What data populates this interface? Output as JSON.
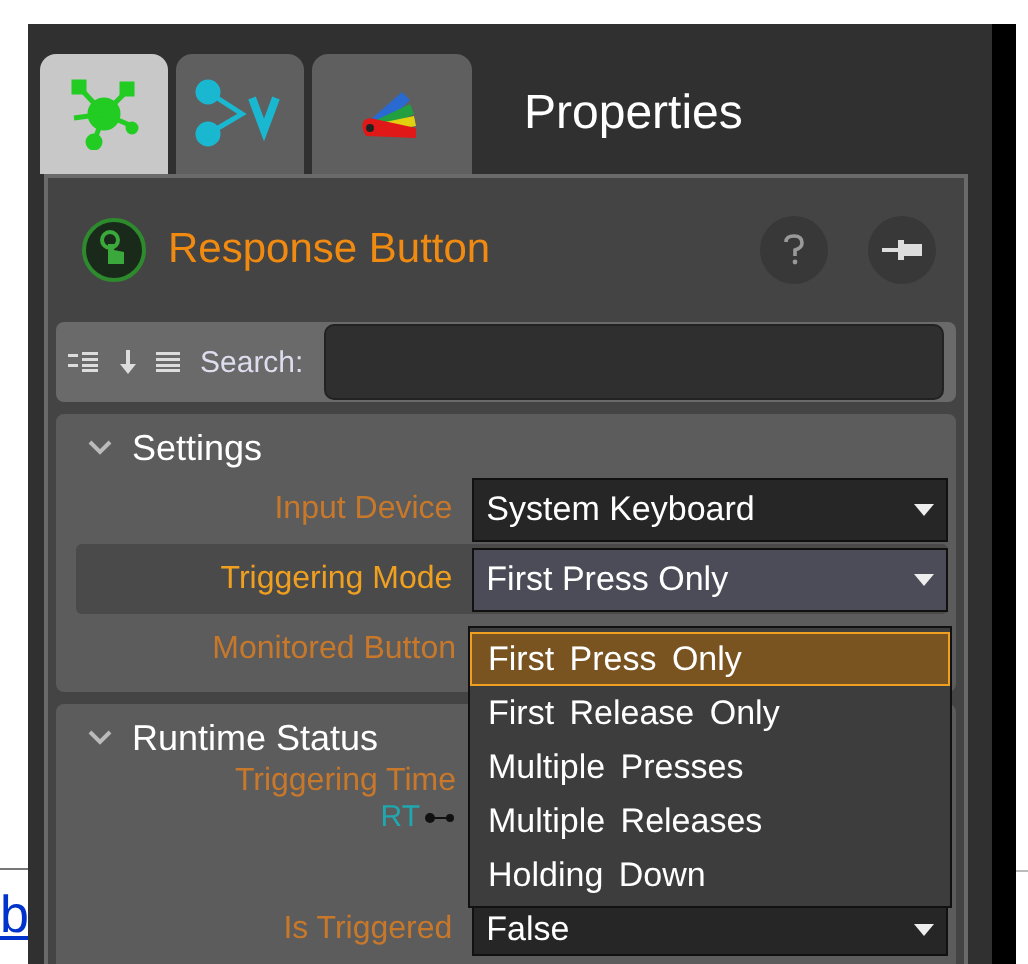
{
  "tabs": [
    {
      "selected": true
    },
    {
      "selected": false
    },
    {
      "selected": false
    }
  ],
  "panel_title": "Properties",
  "component": {
    "title": "Response Button"
  },
  "toolbar": {
    "search_label": "Search:"
  },
  "sections": [
    {
      "title": "Settings",
      "expanded": true,
      "rows": [
        {
          "label": "Input Device",
          "value": "System Keyboard",
          "selected": false
        },
        {
          "label": "Triggering Mode",
          "value": "First Press Only",
          "selected": true
        },
        {
          "label": "Monitored Button",
          "selected": false
        }
      ]
    },
    {
      "title": "Runtime Status",
      "expanded": true,
      "rows": [
        {
          "label": "Triggering Time",
          "tag": "RT",
          "selected": false
        },
        {
          "label": "Is Triggered",
          "value": "False",
          "selected": false
        }
      ]
    }
  ],
  "dropdown": {
    "options": [
      {
        "label": "First Press Only",
        "selected": true
      },
      {
        "label": "First Release Only",
        "selected": false
      },
      {
        "label": "Multiple Presses",
        "selected": false
      },
      {
        "label": "Multiple Releases",
        "selected": false
      },
      {
        "label": "Holding Down",
        "selected": false
      }
    ]
  },
  "page_link": "b"
}
